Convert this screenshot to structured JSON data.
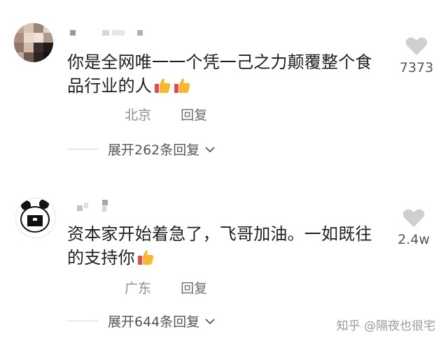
{
  "comments": [
    {
      "text_line1": "你是全网唯一一个凭一己之力颠覆整个食",
      "text_line2": "品行业的人",
      "location": "北京",
      "reply_label": "回复",
      "expand_label": "展开262条回复",
      "likes": "7373"
    },
    {
      "text_line1": "资本家开始着急了，飞哥加油。一如既往",
      "text_line2": "的支持你",
      "location": "广东",
      "reply_label": "回复",
      "expand_label": "展开644条回复",
      "likes": "2.4w"
    }
  ],
  "watermark": "知乎 @隔夜也很宅",
  "colors": {
    "text": "#1e1e1e",
    "meta": "#8e8e8e",
    "heart": "#cfcfcf"
  }
}
